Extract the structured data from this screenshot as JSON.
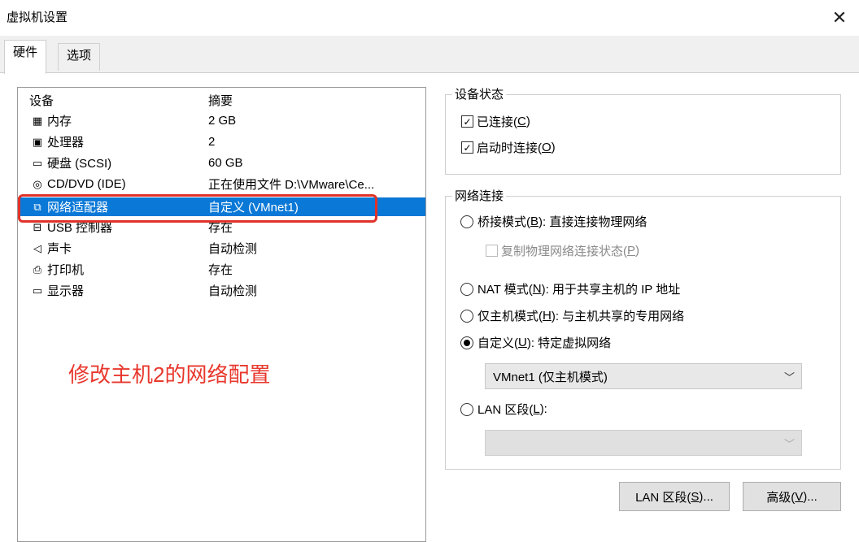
{
  "window": {
    "title": "虚拟机设置",
    "close_glyph": "✕"
  },
  "tabs": [
    {
      "label": "硬件",
      "active": true
    },
    {
      "label": "选项",
      "active": false
    }
  ],
  "device_list": {
    "col_device": "设备",
    "col_summary": "摘要",
    "rows": [
      {
        "icon": "memory-icon",
        "glyph": "▦",
        "name": "内存",
        "summary": "2 GB"
      },
      {
        "icon": "processor-icon",
        "glyph": "▣",
        "name": "处理器",
        "summary": "2"
      },
      {
        "icon": "hard-disk-icon",
        "glyph": "▭",
        "name": "硬盘 (SCSI)",
        "summary": "60 GB"
      },
      {
        "icon": "cd-dvd-icon",
        "glyph": "◎",
        "name": "CD/DVD (IDE)",
        "summary": "正在使用文件 D:\\VMware\\Ce..."
      },
      {
        "icon": "network-adapter-icon",
        "glyph": "⧉",
        "name": "网络适配器",
        "summary": "自定义 (VMnet1)"
      },
      {
        "icon": "usb-controller-icon",
        "glyph": "⊟",
        "name": "USB 控制器",
        "summary": "存在"
      },
      {
        "icon": "sound-card-icon",
        "glyph": "◁",
        "name": "声卡",
        "summary": "自动检测"
      },
      {
        "icon": "printer-icon",
        "glyph": "⎙",
        "name": "打印机",
        "summary": "存在"
      },
      {
        "icon": "display-icon",
        "glyph": "▭",
        "name": "显示器",
        "summary": "自动检测"
      }
    ],
    "selected_index": 4
  },
  "annotation": "修改主机2的网络配置",
  "device_status": {
    "title": "设备状态",
    "connected": {
      "label": "已连接(",
      "key": "C",
      "suffix": ")",
      "checked": true
    },
    "connect_at_power_on": {
      "label": "启动时连接(",
      "key": "O",
      "suffix": ")",
      "checked": true
    }
  },
  "network_connection": {
    "title": "网络连接",
    "bridged": {
      "label": "桥接模式(",
      "key": "B",
      "suffix": "): 直接连接物理网络",
      "selected": false
    },
    "replicate": {
      "label": "复制物理网络连接状态(",
      "key": "P",
      "suffix": ")",
      "checked": false
    },
    "nat": {
      "label": "NAT 模式(",
      "key": "N",
      "suffix": "): 用于共享主机的 IP 地址",
      "selected": false
    },
    "host_only": {
      "label": "仅主机模式(",
      "key": "H",
      "suffix": "): 与主机共享的专用网络",
      "selected": false
    },
    "custom": {
      "label": "自定义(",
      "key": "U",
      "suffix": "): 特定虚拟网络",
      "selected": true
    },
    "custom_value": "VMnet1 (仅主机模式)",
    "lan_segment": {
      "label": "LAN 区段(",
      "key": "L",
      "suffix": "):",
      "selected": false
    },
    "lan_segment_value": ""
  },
  "buttons": {
    "lan_segments": {
      "label": "LAN 区段(",
      "key": "S",
      "suffix": ")..."
    },
    "advanced": {
      "label": "高级(",
      "key": "V",
      "suffix": ")..."
    }
  },
  "colors": {
    "selection": "#0a78d7",
    "annotation": "#e8382d"
  }
}
